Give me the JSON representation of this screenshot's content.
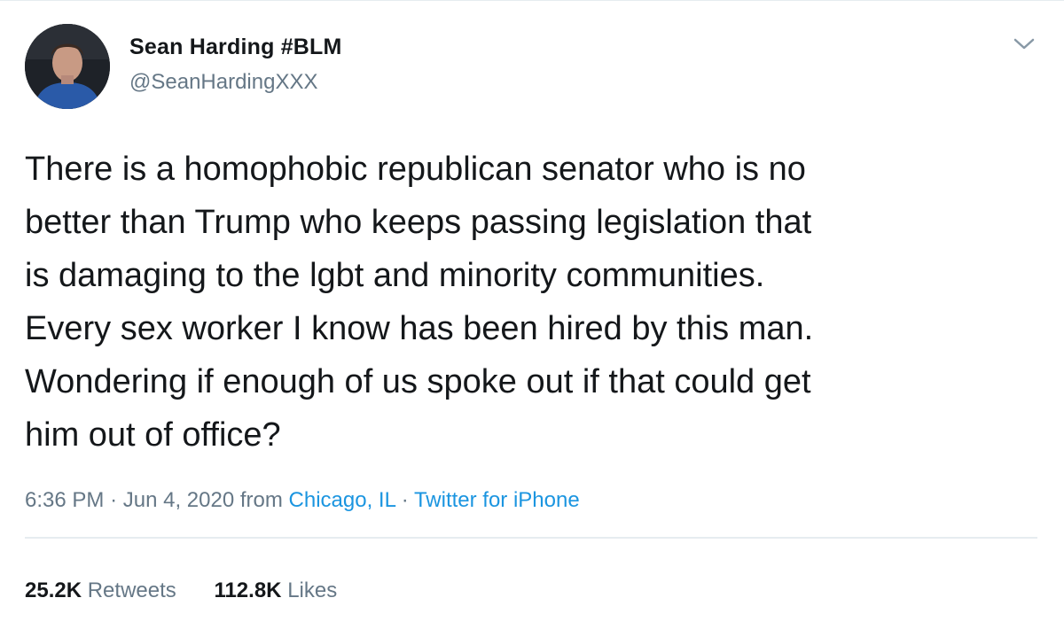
{
  "tweet": {
    "author_name": "Sean Harding #BLM",
    "author_handle": "@SeanHardingXXX",
    "text": "There is a homophobic republican senator who is no\nbetter than Trump who keeps passing legislation that\nis damaging to the lgbt and minority communities.\nEvery sex worker I know has been hired by this man.\nWondering if enough of us spoke out if that could get\nhim out of office?",
    "time": "6:36 PM",
    "separator": "·",
    "date": "Jun 4, 2020",
    "from_label": "from",
    "location": "Chicago, IL",
    "source": "Twitter for iPhone",
    "retweets_count": "25.2K",
    "retweets_label": "Retweets",
    "likes_count": "112.8K",
    "likes_label": "Likes",
    "menu_icon": "chevron-down-icon",
    "avatar_icon": "profile-photo"
  },
  "colors": {
    "text_primary": "#14171a",
    "text_secondary": "#657786",
    "link": "#1b95e0",
    "divider": "#e6ecf0"
  }
}
